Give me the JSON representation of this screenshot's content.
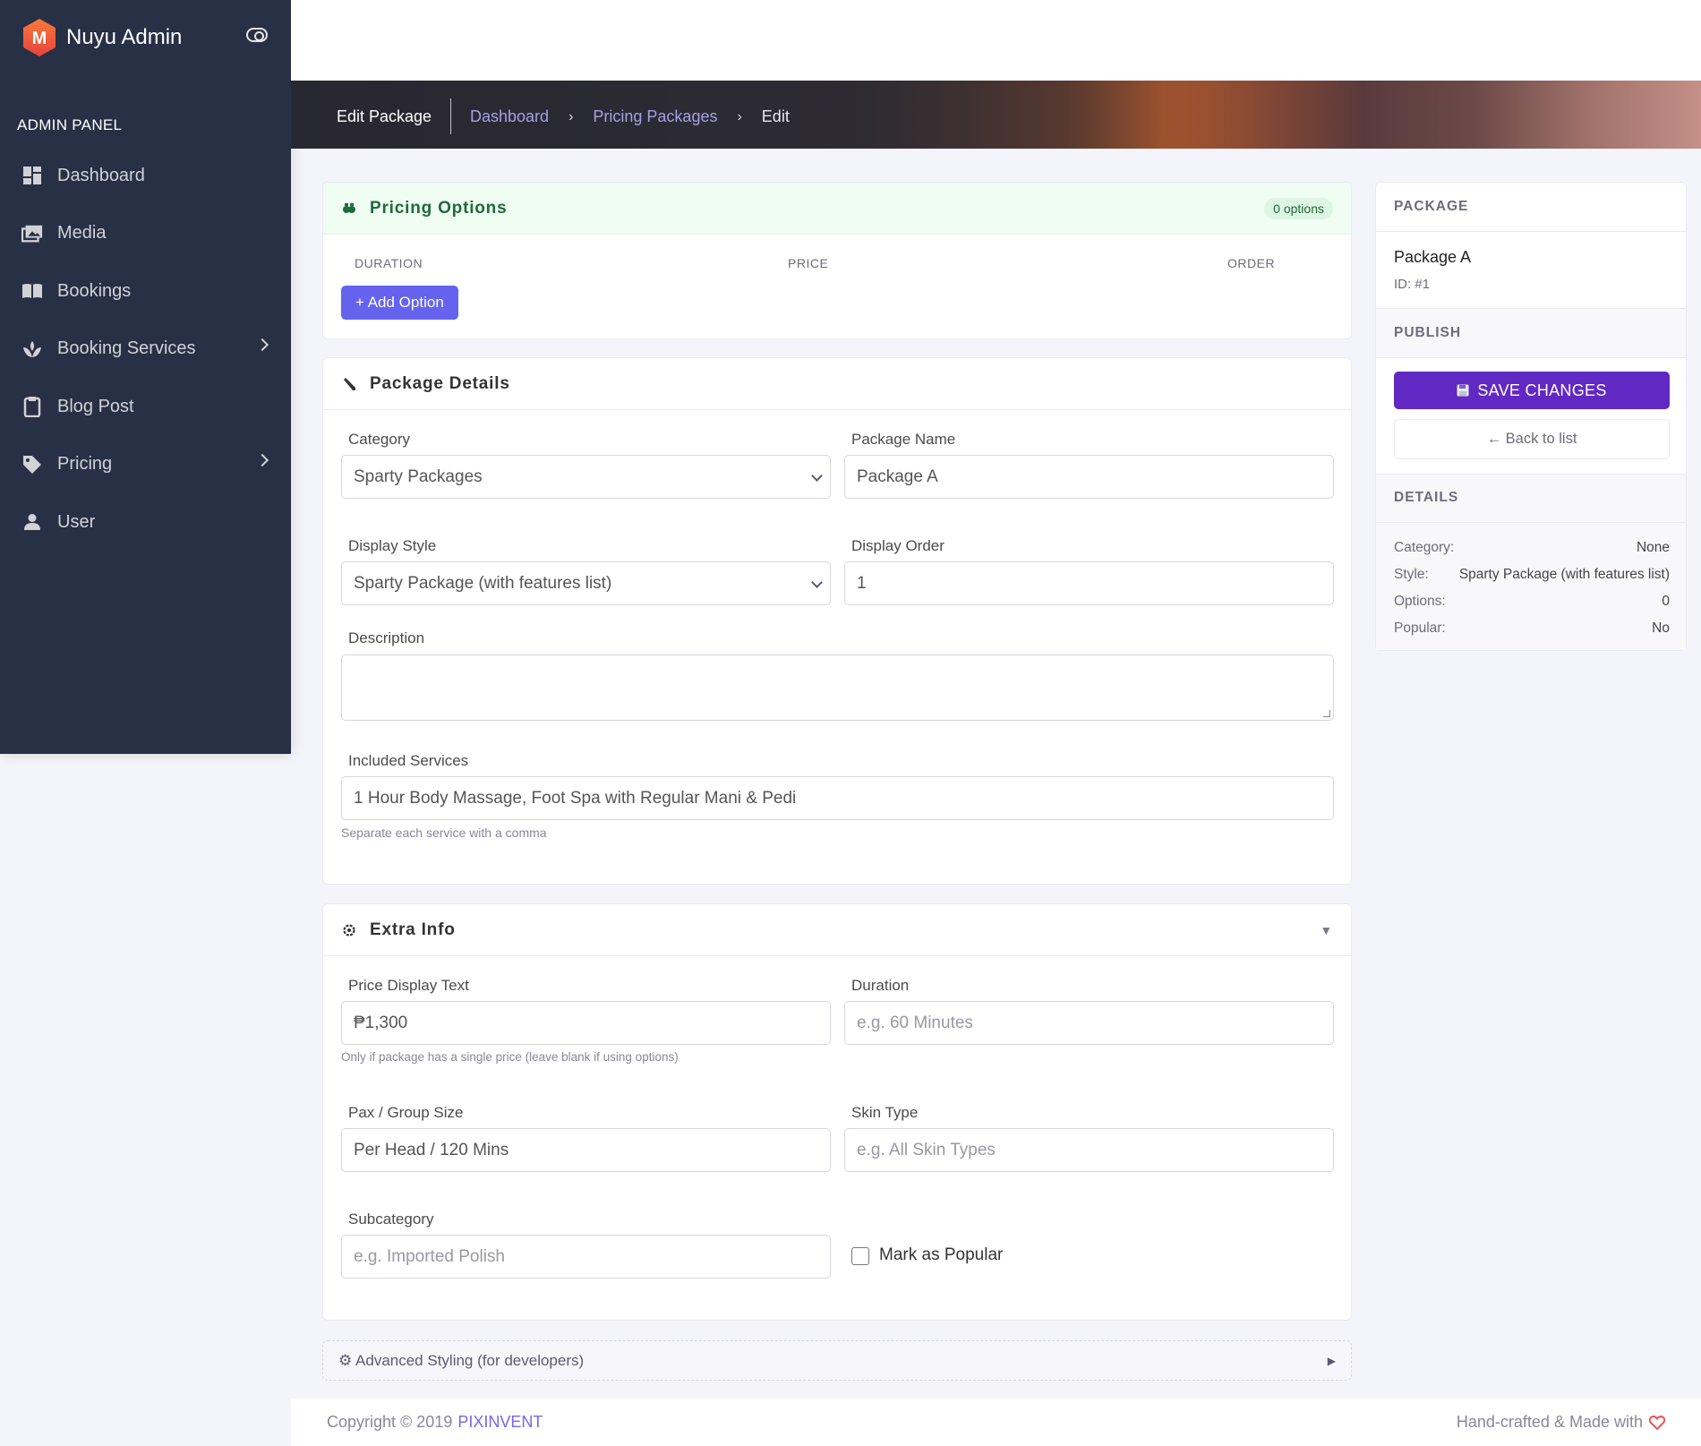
{
  "app": {
    "name": "Nuyu Admin",
    "logo_letter": "M"
  },
  "sidebar": {
    "section": "ADMIN PANEL",
    "items": [
      {
        "label": "Dashboard",
        "icon": "dashboard-icon"
      },
      {
        "label": "Media",
        "icon": "media-icon"
      },
      {
        "label": "Bookings",
        "icon": "book-icon"
      },
      {
        "label": "Booking Services",
        "icon": "spa-icon",
        "has_submenu": true
      },
      {
        "label": "Blog Post",
        "icon": "clipboard-icon"
      },
      {
        "label": "Pricing",
        "icon": "tag-icon",
        "has_submenu": true
      },
      {
        "label": "User",
        "icon": "user-icon"
      }
    ]
  },
  "header": {
    "title": "Edit Package",
    "breadcrumb": [
      "Dashboard",
      "Pricing Packages",
      "Edit"
    ]
  },
  "pricing_options": {
    "title": "Pricing Options",
    "count_badge": "0 options",
    "columns": [
      "DURATION",
      "PRICE",
      "ORDER"
    ],
    "add_button": "+ Add Option"
  },
  "package_details": {
    "title": "Package Details",
    "category": {
      "label": "Category",
      "value": "Sparty Packages"
    },
    "package_name": {
      "label": "Package Name",
      "value": "Package A"
    },
    "display_style": {
      "label": "Display Style",
      "value": "Sparty Package (with features list)"
    },
    "display_order": {
      "label": "Display Order",
      "value": "1"
    },
    "description": {
      "label": "Description",
      "value": ""
    },
    "included_services": {
      "label": "Included Services",
      "value": "1 Hour Body Massage, Foot Spa with Regular Mani & Pedi",
      "help": "Separate each service with a comma"
    }
  },
  "extra_info": {
    "title": "Extra Info",
    "toggle": "▼",
    "price_display_text": {
      "label": "Price Display Text",
      "value": "₱1,300",
      "help": "Only if package has a single price (leave blank if using options)"
    },
    "duration": {
      "label": "Duration",
      "placeholder": "e.g. 60 Minutes"
    },
    "pax_group_size": {
      "label": "Pax / Group Size",
      "value": "Per Head / 120 Mins"
    },
    "skin_type": {
      "label": "Skin Type",
      "placeholder": "e.g. All Skin Types"
    },
    "subcategory": {
      "label": "Subcategory",
      "placeholder": "e.g. Imported Polish"
    },
    "mark_popular": {
      "label": "Mark as Popular",
      "checked": false
    }
  },
  "advanced": {
    "label": "⚙ Advanced Styling (for developers)",
    "toggle": "▶"
  },
  "side_panel": {
    "package_heading": "PACKAGE",
    "package_name": "Package A",
    "package_id": "ID: #1",
    "publish_heading": "PUBLISH",
    "save_button": "SAVE CHANGES",
    "back_button": "← Back to list",
    "details_heading": "DETAILS",
    "details": [
      {
        "key": "Category:",
        "value": "None"
      },
      {
        "key": "Style:",
        "value": "Sparty Package (with features list)"
      },
      {
        "key": "Options:",
        "value": "0"
      },
      {
        "key": "Popular:",
        "value": "No"
      }
    ]
  },
  "footer": {
    "copyright": "Copyright © 2019",
    "brand": "PIXINVENT",
    "made_with": "Hand-crafted & Made with"
  },
  "colors": {
    "sidebar_bg": "#283046",
    "primary": "#7367f0",
    "add_button": "#6563ee",
    "save_button": "#6128c4",
    "pricing_header_bg": "#effdf3",
    "pricing_header_text": "#1e6a3a",
    "logo_orange": "#f0642a",
    "heart": "#ea5455"
  }
}
